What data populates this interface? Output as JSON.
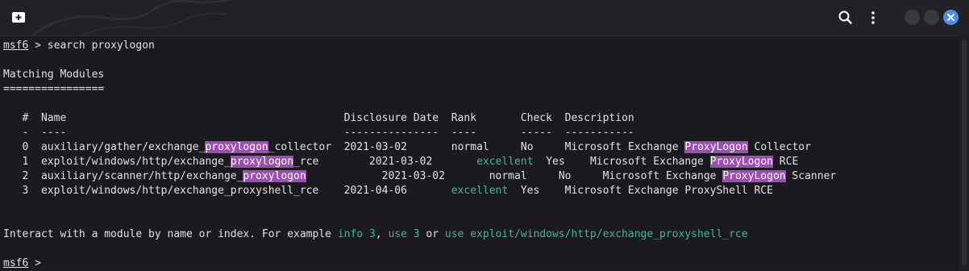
{
  "window": {
    "new_tab_icon": "new-tab-icon",
    "search_icon": "search-icon",
    "menu_icon": "kebab-menu-icon",
    "close_icon": "close-icon",
    "accent": "#4a90e2"
  },
  "terminal": {
    "prompt_name": "msf6",
    "prompt_arrow": " > ",
    "command": "search proxylogon",
    "section_title": "Matching Modules",
    "section_rule": "================",
    "columns": {
      "num": "#",
      "name": "Name",
      "date": "Disclosure Date",
      "rank": "Rank",
      "check": "Check",
      "desc": "Description"
    },
    "column_dashes": {
      "num": "-",
      "name": "----",
      "date": "---------------",
      "rank": "----",
      "check": "-----",
      "desc": "-----------"
    },
    "modules": [
      {
        "num": "0",
        "name_pre": "auxiliary/gather/exchange_",
        "name_match": "proxylogon",
        "name_post": "_collector",
        "date": "2021-03-02",
        "rank": "normal",
        "check": "No",
        "desc_pre": "Microsoft Exchange ",
        "desc_match": "ProxyLogon",
        "desc_post": " Collector"
      },
      {
        "num": "1",
        "name_pre": "exploit/windows/http/exchange_",
        "name_match": "proxylogon",
        "name_post": "_rce",
        "date": "2021-03-02",
        "rank": "excellent",
        "check": "Yes",
        "desc_pre": "Microsoft Exchange ",
        "desc_match": "ProxyLogon",
        "desc_post": " RCE"
      },
      {
        "num": "2",
        "name_pre": "auxiliary/scanner/http/exchange_",
        "name_match": "proxylogon",
        "name_post": "",
        "date": "2021-03-02",
        "rank": "normal",
        "check": "No",
        "desc_pre": "Microsoft Exchange ",
        "desc_match": "ProxyLogon",
        "desc_post": " Scanner"
      },
      {
        "num": "3",
        "name_pre": "exploit/windows/http/exchange_proxyshell_rce",
        "name_match": "",
        "name_post": "",
        "date": "2021-04-06",
        "rank": "excellent",
        "check": "Yes",
        "desc_pre": "Microsoft Exchange ProxyShell RCE",
        "desc_match": "",
        "desc_post": ""
      }
    ],
    "hint_pre": "Interact with a module by name or index. For example ",
    "hint_cmd1": "info 3",
    "hint_sep1": ", ",
    "hint_cmd2": "use 3",
    "hint_sep2": " or ",
    "hint_cmd3": "use exploit/windows/http/exchange_proxyshell_rce",
    "final_prompt_name": "msf6",
    "final_prompt_arrow": " > ",
    "colors": {
      "match_highlight": "#9b4fb0",
      "excellent_rank": "#44b59b",
      "text": "#e2e2e2"
    }
  }
}
